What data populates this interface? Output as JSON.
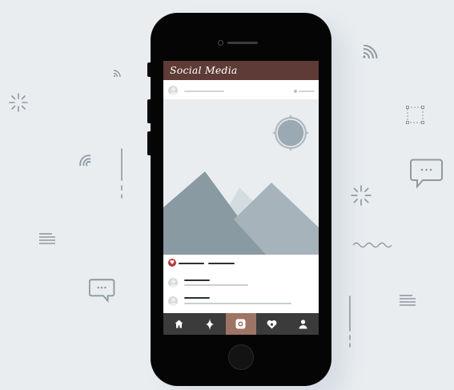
{
  "app": {
    "title": "Social Media"
  },
  "tabs": [
    {
      "name": "home",
      "icon": "home-icon"
    },
    {
      "name": "explore",
      "icon": "sparkle-icon"
    },
    {
      "name": "camera",
      "icon": "camera-icon",
      "active": true
    },
    {
      "name": "likes",
      "icon": "heart-icon"
    },
    {
      "name": "profile",
      "icon": "person-icon"
    }
  ],
  "colors": {
    "background": "#e9edf0",
    "header": "#5e3b36",
    "tabbar": "#3b3b3b",
    "active_tab": "#9e7466",
    "like": "#b53a3a",
    "decoration": "#8d9aa3"
  }
}
